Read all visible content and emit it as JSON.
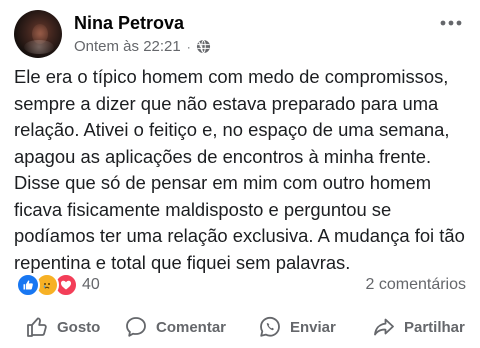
{
  "post": {
    "author": "Nina Petrova",
    "timestamp": "Ontem às 22:21",
    "separator": "·",
    "audience_icon": "globe-icon",
    "more_icon": "more-horizontal-icon",
    "text": "Ele era o típico homem com medo de compromissos, sempre a dizer que não estava preparado para uma relação. Ativei o feitiço e, no espaço de uma semana, apagou as aplicações de encontros à minha frente. Disse que só de pensar em mim com outro homem ficava fisicamente maldisposto e perguntou se podíamos ter uma relação exclusiva. A mudança foi tão repentina e total que fiquei sem palavras."
  },
  "reactions": {
    "icons": [
      "like-reaction-icon",
      "sad-reaction-icon",
      "love-reaction-icon"
    ],
    "count": "40",
    "comments": "2 comentários"
  },
  "actions": {
    "like": "Gosto",
    "comment": "Comentar",
    "send": "Enviar",
    "share": "Partilhar"
  },
  "colors": {
    "text": "#1c1e21",
    "secondary": "#65676b",
    "like_blue": "#1877f2",
    "love_red": "#f33e58",
    "sad_yellow": "#f7b125"
  }
}
